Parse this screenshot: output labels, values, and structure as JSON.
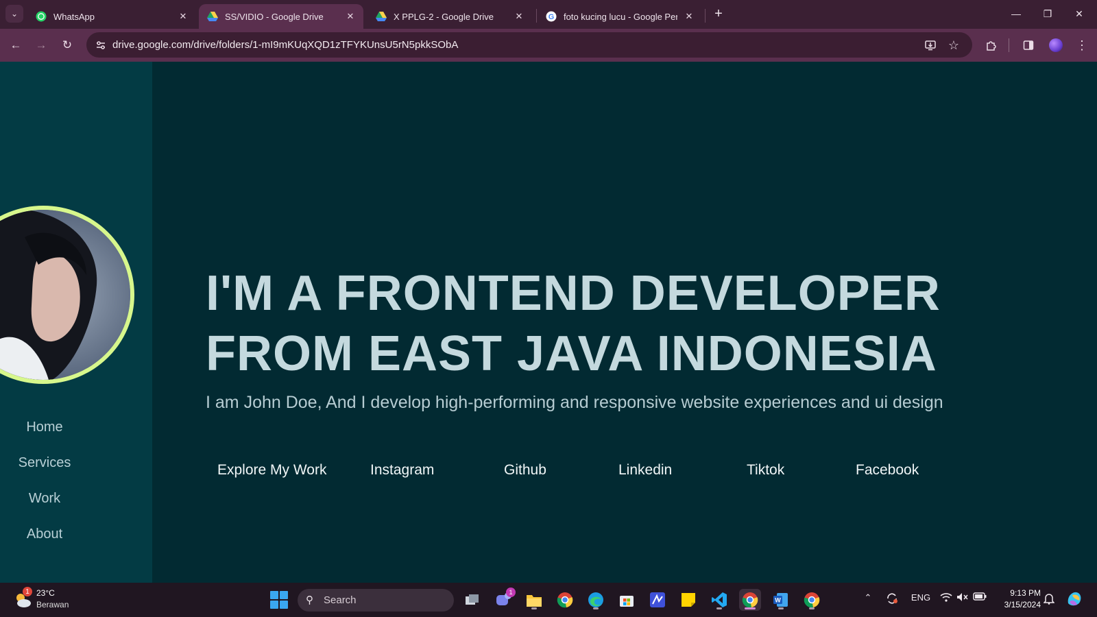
{
  "browser": {
    "tabs": [
      {
        "title": "WhatsApp",
        "icon": "whatsapp-icon",
        "active": false
      },
      {
        "title": "SS/VIDIO - Google Drive",
        "icon": "google-drive-icon",
        "active": true
      },
      {
        "title": "X PPLG-2 - Google Drive",
        "icon": "google-drive-icon",
        "active": false
      },
      {
        "title": "foto kucing lucu - Google Penel",
        "icon": "google-icon",
        "active": false
      }
    ],
    "url": "drive.google.com/drive/folders/1-mI9mKUqXQD1zTFYKUnsU5rN5pkkSObA"
  },
  "page": {
    "sidebar": {
      "nav": [
        "Home",
        "Services",
        "Work",
        "About"
      ],
      "avatar_ring_color": "#d7f78c"
    },
    "hero": {
      "headline_line1": "I'M A FRONTEND DEVELOPER",
      "headline_line2": "FROM EAST JAVA INDONESIA",
      "subtitle": "I am John Doe, And I develop high-performing and responsive website experiences and ui design"
    },
    "links": [
      "Explore My Work",
      "Instagram",
      "Github",
      "Linkedin",
      "Tiktok",
      "Facebook"
    ]
  },
  "taskbar": {
    "weather": {
      "badge": "1",
      "temp": "23°C",
      "desc": "Berawan"
    },
    "search_label": "Search",
    "teams_badge": "1",
    "language": "ENG",
    "time": "9:13 PM",
    "date": "3/15/2024"
  },
  "colors": {
    "page_bg": "#022a32",
    "sidebar_bg": "#033b44",
    "headline": "#c4d9de",
    "accent_ring": "#d7f78c",
    "browser_frame": "#5a2f4e"
  }
}
